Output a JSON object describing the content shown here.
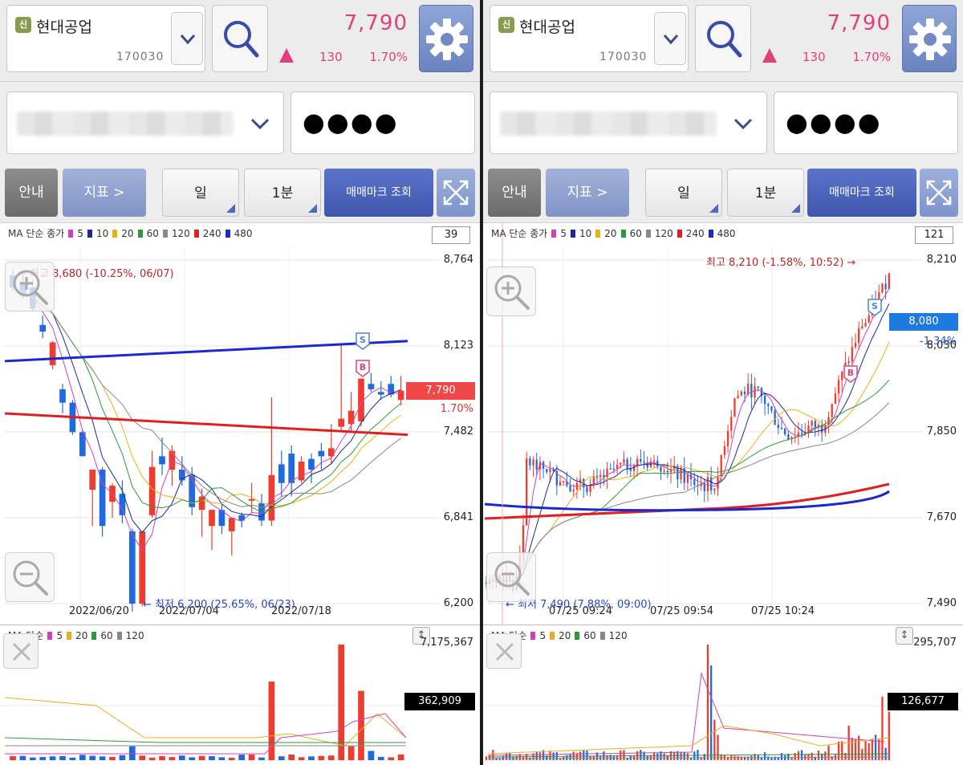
{
  "panels": [
    {
      "stock": {
        "badge": "신",
        "name": "현대공업",
        "code": "170030"
      },
      "quote": {
        "price": "7,790",
        "change": "130",
        "change_pct": "1.70%"
      },
      "account": {
        "password_mask": "●●●●"
      },
      "toolbar": {
        "guide": "안내",
        "indicator": "지표 >",
        "period": "일",
        "interval": "1분",
        "trade_mark": "매매마크 조회"
      },
      "legend": {
        "prefix": "MA 단순 종가",
        "items": [
          {
            "label": "5",
            "color": "#d43fbf"
          },
          {
            "label": "10",
            "color": "#1a2a9a"
          },
          {
            "label": "20",
            "color": "#e8b018"
          },
          {
            "label": "60",
            "color": "#2a9a3a"
          },
          {
            "label": "120",
            "color": "#888888"
          },
          {
            "label": "240",
            "color": "#e02020"
          },
          {
            "label": "480",
            "color": "#1a28d0"
          }
        ]
      },
      "count": "39",
      "y_ticks": [
        "8,764",
        "8,123",
        "7,482",
        "6,841",
        "6,200"
      ],
      "x_ticks": [
        "2022/06/20",
        "2022/07/04",
        "2022/07/18"
      ],
      "current_price_tag": "7,790",
      "current_tag_color": "#f04848",
      "pct_label": "1.70%",
      "pct_color": "#e03030",
      "high_note": "← 최고 8,680 (-10.25%, 06/07)",
      "low_note": "← 최저 6,200 (25.65%, 06/23)",
      "vol_legend": {
        "prefix": "MA 단순",
        "items": [
          {
            "label": "5",
            "color": "#d43fbf"
          },
          {
            "label": "20",
            "color": "#e8b018"
          },
          {
            "label": "60",
            "color": "#2a9a3a"
          },
          {
            "label": "120",
            "color": "#888888"
          }
        ]
      },
      "vol_max": "7,175,367",
      "vol_current": "362,909",
      "chart_data": {
        "type": "candlestick",
        "interval": "daily",
        "y_range": [
          6200,
          8764
        ],
        "candles": [
          [
            8650,
            8700,
            8540,
            8560
          ],
          [
            8600,
            8680,
            8480,
            8500
          ],
          [
            8560,
            8620,
            8380,
            8400
          ],
          [
            8280,
            8350,
            8180,
            8230
          ],
          [
            7980,
            8160,
            7950,
            8150
          ],
          [
            7800,
            7840,
            7620,
            7700
          ],
          [
            7700,
            7720,
            7460,
            7480
          ],
          [
            7480,
            7500,
            7300,
            7300
          ],
          [
            7050,
            7120,
            6780,
            7200
          ],
          [
            7200,
            7220,
            6700,
            6780
          ],
          [
            6960,
            7100,
            6840,
            7080
          ],
          [
            7020,
            7120,
            6800,
            6860
          ],
          [
            6740,
            6760,
            6140,
            6200
          ],
          [
            6200,
            6740,
            6180,
            6740
          ],
          [
            6860,
            7340,
            6840,
            7220
          ],
          [
            7300,
            7440,
            7160,
            7240
          ],
          [
            7200,
            7380,
            7080,
            7340
          ],
          [
            7200,
            7300,
            7080,
            7120
          ],
          [
            7160,
            7220,
            6860,
            6920
          ],
          [
            6900,
            7060,
            6700,
            7000
          ],
          [
            6780,
            6900,
            6600,
            6900
          ],
          [
            6900,
            6940,
            6720,
            6780
          ],
          [
            6740,
            6800,
            6560,
            6840
          ],
          [
            6860,
            6880,
            6770,
            6820
          ],
          [
            6980,
            7100,
            6880,
            6980
          ],
          [
            6950,
            7020,
            6780,
            6820
          ],
          [
            6820,
            7740,
            6780,
            7160
          ],
          [
            7240,
            7340,
            7000,
            7100
          ],
          [
            7320,
            7380,
            7000,
            7100
          ],
          [
            7120,
            7300,
            7100,
            7260
          ],
          [
            7280,
            7320,
            7100,
            7200
          ],
          [
            7340,
            7400,
            7200,
            7300
          ],
          [
            7300,
            7540,
            7240,
            7360
          ],
          [
            7520,
            8140,
            7480,
            7580
          ],
          [
            7540,
            7780,
            7480,
            7640
          ],
          [
            7560,
            7880,
            7520,
            7880
          ],
          [
            7840,
            7920,
            7780,
            7800
          ],
          [
            7780,
            7860,
            7720,
            7760
          ],
          [
            7840,
            7900,
            7740,
            7760
          ],
          [
            7720,
            7900,
            7680,
            7790
          ]
        ],
        "ma_240_endpoints": [
          7620,
          7460
        ],
        "ma_480_endpoints": [
          8010,
          8160
        ],
        "volume_max": 7175367,
        "volume_current": 362909
      }
    },
    {
      "stock": {
        "badge": "신",
        "name": "현대공업",
        "code": "170030"
      },
      "quote": {
        "price": "7,790",
        "change": "130",
        "change_pct": "1.70%"
      },
      "account": {
        "password_mask": "●●●●"
      },
      "toolbar": {
        "guide": "안내",
        "indicator": "지표 >",
        "period": "일",
        "interval": "1분",
        "trade_mark": "매매마크 조회"
      },
      "legend": {
        "prefix": "MA 단순 종가",
        "items": [
          {
            "label": "5",
            "color": "#d43fbf"
          },
          {
            "label": "10",
            "color": "#1a2a9a"
          },
          {
            "label": "20",
            "color": "#e8b018"
          },
          {
            "label": "60",
            "color": "#2a9a3a"
          },
          {
            "label": "120",
            "color": "#888888"
          },
          {
            "label": "240",
            "color": "#e02020"
          },
          {
            "label": "480",
            "color": "#1a28d0"
          }
        ]
      },
      "count": "121",
      "y_ticks": [
        "8,210",
        "8,030",
        "7,850",
        "7,670",
        "7,490"
      ],
      "x_ticks": [
        "07/25 09:24",
        "07/25 09:54",
        "07/25 10:24"
      ],
      "current_price_tag": "8,080",
      "current_tag_color": "#1f7ae0",
      "pct_label": "-1.34%",
      "pct_color": "#2a55c4",
      "high_note": "최고 8,210 (-1.58%, 10:52) →",
      "low_note": "← 최저 7,490 (7.88%, 09:00)",
      "vol_legend": {
        "prefix": "MA 단순",
        "items": [
          {
            "label": "5",
            "color": "#d43fbf"
          },
          {
            "label": "20",
            "color": "#e8b018"
          },
          {
            "label": "60",
            "color": "#2a9a3a"
          },
          {
            "label": "120",
            "color": "#888888"
          }
        ]
      },
      "vol_max": "295,707",
      "vol_current": "126,677",
      "chart_data": {
        "type": "candlestick",
        "interval": "1min",
        "y_range": [
          7490,
          8210
        ],
        "volume_max": 295707,
        "volume_current": 126677
      }
    }
  ]
}
